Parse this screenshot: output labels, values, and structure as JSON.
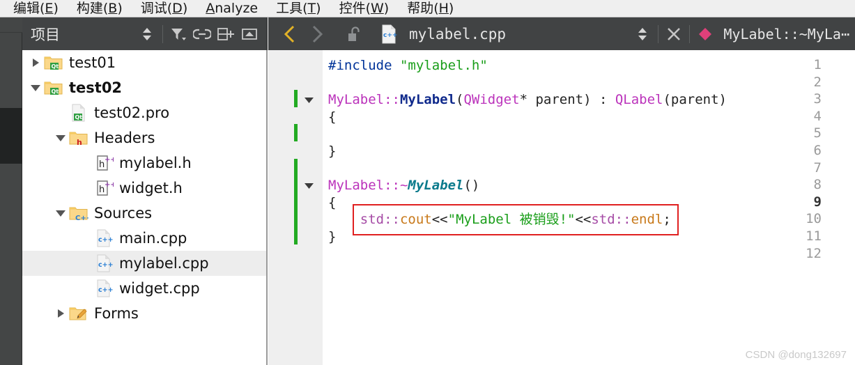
{
  "menubar": {
    "items": [
      {
        "text": "编辑(E)",
        "accel": "E"
      },
      {
        "text": "构建(B)",
        "accel": "B"
      },
      {
        "text": "调试(D)",
        "accel": "D"
      },
      {
        "text": "Analyze",
        "accel": "A"
      },
      {
        "text": "工具(T)",
        "accel": "T"
      },
      {
        "text": "控件(W)",
        "accel": "W"
      },
      {
        "text": "帮助(H)",
        "accel": "H"
      }
    ]
  },
  "project_panel": {
    "title": "项目",
    "icons": [
      {
        "name": "sync-selection-icon",
        "glyph": "updown-arrows"
      },
      {
        "name": "filter-icon",
        "glyph": "funnel"
      },
      {
        "name": "link-icon",
        "glyph": "chain"
      },
      {
        "name": "split-add-icon",
        "glyph": "split-plus"
      },
      {
        "name": "collapse-icon",
        "glyph": "minimize-box"
      }
    ]
  },
  "editor_toolbar": {
    "back_label": "‹",
    "forward_label": "›",
    "lock_state": "unlocked",
    "file_icon": "c++",
    "filename": "mylabel.cpp",
    "symbol": "MyLabel::~MyLa⋯",
    "close_label": "✕"
  },
  "tree": {
    "items": [
      {
        "label": "test01",
        "indent": 0,
        "arrow": "right",
        "icon": "qt-folder",
        "bold": false,
        "selected": false
      },
      {
        "label": "test02",
        "indent": 0,
        "arrow": "down",
        "icon": "qt-folder",
        "bold": true,
        "selected": false
      },
      {
        "label": "test02.pro",
        "indent": 1,
        "arrow": "none",
        "icon": "qt-file",
        "bold": false,
        "selected": false
      },
      {
        "label": "Headers",
        "indent": 1,
        "arrow": "down",
        "icon": "h-folder",
        "bold": false,
        "selected": false
      },
      {
        "label": "mylabel.h",
        "indent": 2,
        "arrow": "none",
        "icon": "hpp-file",
        "bold": false,
        "selected": false
      },
      {
        "label": "widget.h",
        "indent": 2,
        "arrow": "none",
        "icon": "hpp-file",
        "bold": false,
        "selected": false
      },
      {
        "label": "Sources",
        "indent": 1,
        "arrow": "down",
        "icon": "cpp-folder",
        "bold": false,
        "selected": false
      },
      {
        "label": "main.cpp",
        "indent": 2,
        "arrow": "none",
        "icon": "cpp-file",
        "bold": false,
        "selected": false
      },
      {
        "label": "mylabel.cpp",
        "indent": 2,
        "arrow": "none",
        "icon": "cpp-file",
        "bold": false,
        "selected": true
      },
      {
        "label": "widget.cpp",
        "indent": 2,
        "arrow": "none",
        "icon": "cpp-file",
        "bold": false,
        "selected": false
      },
      {
        "label": "Forms",
        "indent": 1,
        "arrow": "right",
        "icon": "forms-folder",
        "bold": false,
        "selected": false
      }
    ]
  },
  "editor": {
    "lines": [
      {
        "n": "1",
        "current": false,
        "fold": false,
        "change": false,
        "tokens": [
          {
            "t": "#include ",
            "c": "k-inc"
          },
          {
            "t": "\"mylabel.h\"",
            "c": "k-str"
          }
        ]
      },
      {
        "n": "2",
        "current": false,
        "fold": false,
        "change": false,
        "tokens": []
      },
      {
        "n": "3",
        "current": false,
        "fold": true,
        "change": true,
        "tokens": [
          {
            "t": "MyLabel::",
            "c": "k-cls"
          },
          {
            "t": "MyLabel",
            "c": "k-fn"
          },
          {
            "t": "(",
            "c": "k-plain"
          },
          {
            "t": "QWidget",
            "c": "k-cls"
          },
          {
            "t": "* parent) : ",
            "c": "k-plain"
          },
          {
            "t": "QLabel",
            "c": "k-cls"
          },
          {
            "t": "(parent)",
            "c": "k-plain"
          }
        ]
      },
      {
        "n": "4",
        "current": false,
        "fold": false,
        "change": false,
        "tokens": [
          {
            "t": "{",
            "c": "k-plain"
          }
        ]
      },
      {
        "n": "5",
        "current": false,
        "fold": false,
        "change": true,
        "tokens": []
      },
      {
        "n": "6",
        "current": false,
        "fold": false,
        "change": false,
        "tokens": [
          {
            "t": "}",
            "c": "k-plain"
          }
        ]
      },
      {
        "n": "7",
        "current": false,
        "fold": false,
        "change": true,
        "tokens": []
      },
      {
        "n": "8",
        "current": false,
        "fold": true,
        "change": true,
        "tokens": [
          {
            "t": "MyLabel::~",
            "c": "k-cls"
          },
          {
            "t": "MyLabel",
            "c": "k-dtor"
          },
          {
            "t": "()",
            "c": "k-plain"
          }
        ]
      },
      {
        "n": "9",
        "current": true,
        "fold": false,
        "change": true,
        "tokens": [
          {
            "t": "{",
            "c": "k-plain"
          }
        ]
      },
      {
        "n": "10",
        "current": false,
        "fold": false,
        "change": true,
        "tokens": [
          {
            "t": "    ",
            "c": "k-plain"
          },
          {
            "t": "std::",
            "c": "k-ns"
          },
          {
            "t": "cout",
            "c": "k-var"
          },
          {
            "t": "<<",
            "c": "k-plain"
          },
          {
            "t": "\"MyLabel 被销毁!\"",
            "c": "k-str"
          },
          {
            "t": "<<",
            "c": "k-plain"
          },
          {
            "t": "std::",
            "c": "k-ns"
          },
          {
            "t": "endl",
            "c": "k-var"
          },
          {
            "t": ";",
            "c": "k-plain"
          }
        ]
      },
      {
        "n": "11",
        "current": false,
        "fold": false,
        "change": true,
        "tokens": [
          {
            "t": "}",
            "c": "k-plain"
          }
        ]
      },
      {
        "n": "12",
        "current": false,
        "fold": false,
        "change": false,
        "tokens": []
      }
    ],
    "annotation": {
      "color": "#e02020",
      "target_line": "10"
    }
  },
  "watermark": {
    "text": "CSDN @dong132697"
  },
  "colors": {
    "toolbar_bg": "#414344",
    "mode_strip_bg": "#444646",
    "mode_selected_bg": "#212323",
    "gutter_bg": "#efefef",
    "change_bar": "#22aa22",
    "selection_bg": "#ededed",
    "annotation": "#e02020",
    "back_arrow": "#e2b227",
    "symbol_diamond": "#e0407a"
  }
}
